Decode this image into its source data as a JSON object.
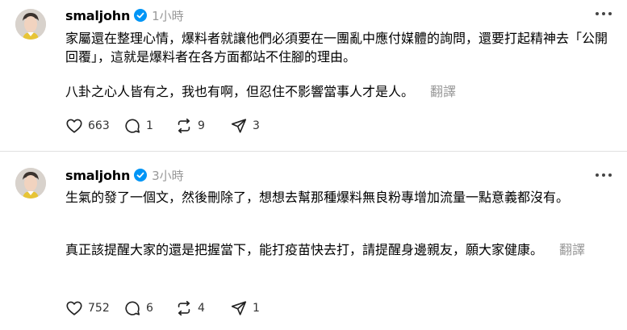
{
  "posts": [
    {
      "username": "smaljohn",
      "time": "1小時",
      "paragraphs": [
        "家屬還在整理心情，爆料者就讓他們必須要在一團亂中應付媒體的詢問，還要打起精神去「公開回覆」，這就是爆料者在各方面都站不住腳的理由。",
        "八卦之心人皆有之，我也有啊，但忍住不影響當事人才是人。"
      ],
      "translate_label": "翻譯",
      "likes": "663",
      "replies": "1",
      "reposts": "9",
      "shares": "3"
    },
    {
      "username": "smaljohn",
      "time": "3小時",
      "paragraphs": [
        "生氣的發了一個文，然後刪除了，想想去幫那種爆料無良粉專增加流量一點意義都沒有。",
        "真正該提醒大家的還是把握當下，能打疫苗快去打，請提醒身邊親友，願大家健康。"
      ],
      "translate_label": "翻譯",
      "likes": "752",
      "replies": "6",
      "reposts": "4",
      "shares": "1"
    }
  ],
  "icons": {
    "verified": "verified-badge-icon",
    "more": "more-options-icon",
    "like": "heart-icon",
    "reply": "comment-icon",
    "repost": "repost-icon",
    "share": "send-icon"
  },
  "colors": {
    "verified": "#0095f6",
    "muted": "#999999",
    "divider": "#e0e0e0"
  }
}
